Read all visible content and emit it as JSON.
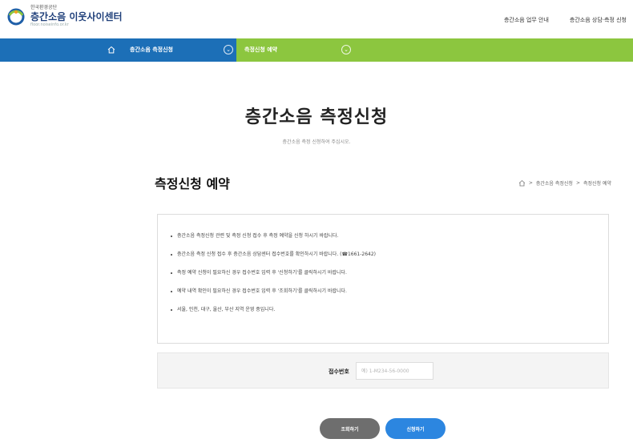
{
  "header": {
    "org": "한국환경공단",
    "title": "층간소음 이웃사이센터",
    "url": "floor.noiseinfo.or.kr",
    "links": [
      "층간소음 업무 안내",
      "층간소음 상담·측정 신청"
    ]
  },
  "location": {
    "current": "층간소음 측정신청",
    "sub": "측정신청 예약"
  },
  "page": {
    "title": "층간소음 측정신청",
    "subtitle": "층간소음 측정 신청하여 주십시오."
  },
  "section": {
    "title": "측정신청 예약",
    "breadcrumb": [
      "층간소음 측정신청",
      "측정신청 예약"
    ]
  },
  "notices": [
    "층간소음 측정신청 관련 및 측정 신청 접수 후 측정 예약을 신청 하시기 바랍니다.",
    "층간소음 측정 신청 접수 후 층간소음 상담센터 접수번호를 확인하시기 바랍니다. (☎1661-2642)",
    "측정 예약 신청이 필요하신 경우 접수번호 입력 후 '신청하기'를 클릭하시기 바랍니다.",
    "예약 내역 확인이 필요하신 경우 접수번호 입력 후 '조회하기'를 클릭하시기 바랍니다.",
    "서울, 인천, 대구, 울산, 부산 지역 운영 중입니다."
  ],
  "search": {
    "label": "접수번호",
    "placeholder": "예) 1-M234-56-0000"
  },
  "buttons": {
    "inquiry": "조회하기",
    "apply": "신청하기"
  },
  "colors": {
    "blue_bar": "#1c6fb7",
    "green_bar": "#8cc63f",
    "btn_gray": "#6e6e6e",
    "btn_blue": "#2c86e0"
  }
}
